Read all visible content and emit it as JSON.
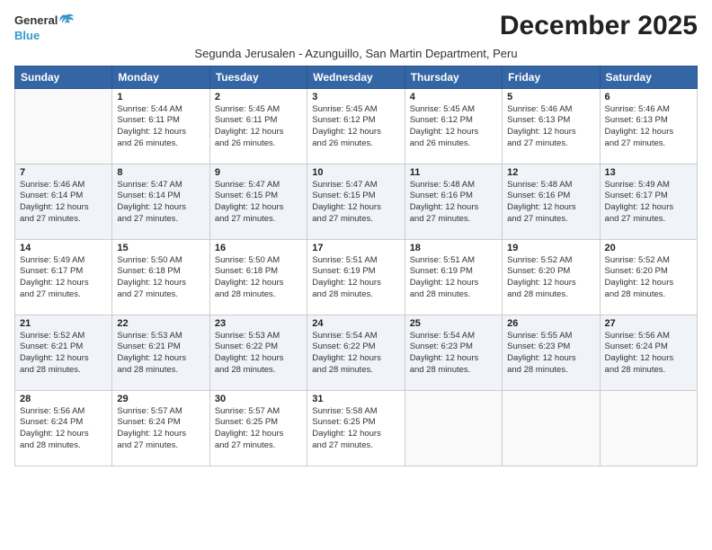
{
  "logo": {
    "general": "General",
    "blue": "Blue"
  },
  "title": "December 2025",
  "subtitle": "Segunda Jerusalen - Azunguillo, San Martin Department, Peru",
  "headers": [
    "Sunday",
    "Monday",
    "Tuesday",
    "Wednesday",
    "Thursday",
    "Friday",
    "Saturday"
  ],
  "weeks": [
    [
      {
        "day": "",
        "info": ""
      },
      {
        "day": "1",
        "info": "Sunrise: 5:44 AM\nSunset: 6:11 PM\nDaylight: 12 hours\nand 26 minutes."
      },
      {
        "day": "2",
        "info": "Sunrise: 5:45 AM\nSunset: 6:11 PM\nDaylight: 12 hours\nand 26 minutes."
      },
      {
        "day": "3",
        "info": "Sunrise: 5:45 AM\nSunset: 6:12 PM\nDaylight: 12 hours\nand 26 minutes."
      },
      {
        "day": "4",
        "info": "Sunrise: 5:45 AM\nSunset: 6:12 PM\nDaylight: 12 hours\nand 26 minutes."
      },
      {
        "day": "5",
        "info": "Sunrise: 5:46 AM\nSunset: 6:13 PM\nDaylight: 12 hours\nand 27 minutes."
      },
      {
        "day": "6",
        "info": "Sunrise: 5:46 AM\nSunset: 6:13 PM\nDaylight: 12 hours\nand 27 minutes."
      }
    ],
    [
      {
        "day": "7",
        "info": "Sunrise: 5:46 AM\nSunset: 6:14 PM\nDaylight: 12 hours\nand 27 minutes."
      },
      {
        "day": "8",
        "info": "Sunrise: 5:47 AM\nSunset: 6:14 PM\nDaylight: 12 hours\nand 27 minutes."
      },
      {
        "day": "9",
        "info": "Sunrise: 5:47 AM\nSunset: 6:15 PM\nDaylight: 12 hours\nand 27 minutes."
      },
      {
        "day": "10",
        "info": "Sunrise: 5:47 AM\nSunset: 6:15 PM\nDaylight: 12 hours\nand 27 minutes."
      },
      {
        "day": "11",
        "info": "Sunrise: 5:48 AM\nSunset: 6:16 PM\nDaylight: 12 hours\nand 27 minutes."
      },
      {
        "day": "12",
        "info": "Sunrise: 5:48 AM\nSunset: 6:16 PM\nDaylight: 12 hours\nand 27 minutes."
      },
      {
        "day": "13",
        "info": "Sunrise: 5:49 AM\nSunset: 6:17 PM\nDaylight: 12 hours\nand 27 minutes."
      }
    ],
    [
      {
        "day": "14",
        "info": "Sunrise: 5:49 AM\nSunset: 6:17 PM\nDaylight: 12 hours\nand 27 minutes."
      },
      {
        "day": "15",
        "info": "Sunrise: 5:50 AM\nSunset: 6:18 PM\nDaylight: 12 hours\nand 27 minutes."
      },
      {
        "day": "16",
        "info": "Sunrise: 5:50 AM\nSunset: 6:18 PM\nDaylight: 12 hours\nand 28 minutes."
      },
      {
        "day": "17",
        "info": "Sunrise: 5:51 AM\nSunset: 6:19 PM\nDaylight: 12 hours\nand 28 minutes."
      },
      {
        "day": "18",
        "info": "Sunrise: 5:51 AM\nSunset: 6:19 PM\nDaylight: 12 hours\nand 28 minutes."
      },
      {
        "day": "19",
        "info": "Sunrise: 5:52 AM\nSunset: 6:20 PM\nDaylight: 12 hours\nand 28 minutes."
      },
      {
        "day": "20",
        "info": "Sunrise: 5:52 AM\nSunset: 6:20 PM\nDaylight: 12 hours\nand 28 minutes."
      }
    ],
    [
      {
        "day": "21",
        "info": "Sunrise: 5:52 AM\nSunset: 6:21 PM\nDaylight: 12 hours\nand 28 minutes."
      },
      {
        "day": "22",
        "info": "Sunrise: 5:53 AM\nSunset: 6:21 PM\nDaylight: 12 hours\nand 28 minutes."
      },
      {
        "day": "23",
        "info": "Sunrise: 5:53 AM\nSunset: 6:22 PM\nDaylight: 12 hours\nand 28 minutes."
      },
      {
        "day": "24",
        "info": "Sunrise: 5:54 AM\nSunset: 6:22 PM\nDaylight: 12 hours\nand 28 minutes."
      },
      {
        "day": "25",
        "info": "Sunrise: 5:54 AM\nSunset: 6:23 PM\nDaylight: 12 hours\nand 28 minutes."
      },
      {
        "day": "26",
        "info": "Sunrise: 5:55 AM\nSunset: 6:23 PM\nDaylight: 12 hours\nand 28 minutes."
      },
      {
        "day": "27",
        "info": "Sunrise: 5:56 AM\nSunset: 6:24 PM\nDaylight: 12 hours\nand 28 minutes."
      }
    ],
    [
      {
        "day": "28",
        "info": "Sunrise: 5:56 AM\nSunset: 6:24 PM\nDaylight: 12 hours\nand 28 minutes."
      },
      {
        "day": "29",
        "info": "Sunrise: 5:57 AM\nSunset: 6:24 PM\nDaylight: 12 hours\nand 27 minutes."
      },
      {
        "day": "30",
        "info": "Sunrise: 5:57 AM\nSunset: 6:25 PM\nDaylight: 12 hours\nand 27 minutes."
      },
      {
        "day": "31",
        "info": "Sunrise: 5:58 AM\nSunset: 6:25 PM\nDaylight: 12 hours\nand 27 minutes."
      },
      {
        "day": "",
        "info": ""
      },
      {
        "day": "",
        "info": ""
      },
      {
        "day": "",
        "info": ""
      }
    ]
  ]
}
